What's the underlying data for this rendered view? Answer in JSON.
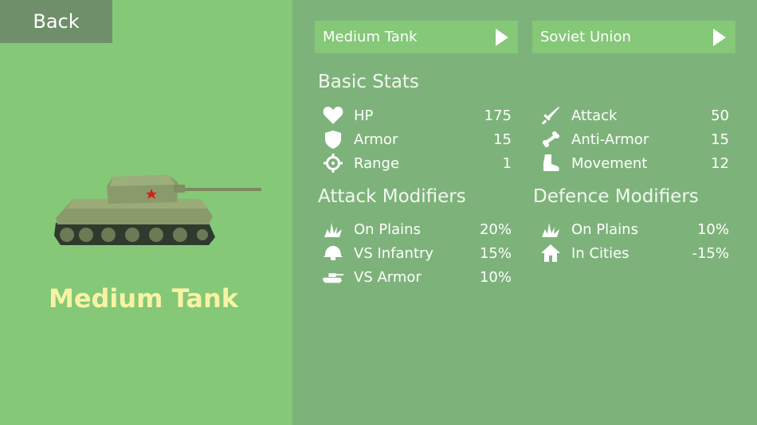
{
  "back_label": "Back",
  "unit": {
    "name": "Medium Tank",
    "selector": "Medium Tank",
    "nation": "Soviet Union"
  },
  "colors": {
    "left_panel": "#84c878",
    "right_panel": "#7db37a",
    "back_button": "#6e8f6a",
    "unit_name": "#f8f3a4",
    "tank_body": "#8a9a6a",
    "star": "#d42020"
  },
  "basic_stats": {
    "title": "Basic Stats",
    "left": [
      {
        "icon": "heart-icon",
        "name": "HP",
        "value": "175"
      },
      {
        "icon": "shield-icon",
        "name": "Armor",
        "value": "15"
      },
      {
        "icon": "crosshair-icon",
        "name": "Range",
        "value": "1"
      }
    ],
    "right": [
      {
        "icon": "sword-icon",
        "name": "Attack",
        "value": "50"
      },
      {
        "icon": "bone-icon",
        "name": "Anti-Armor",
        "value": "15"
      },
      {
        "icon": "boot-icon",
        "name": "Movement",
        "value": "12"
      }
    ]
  },
  "attack_modifiers": {
    "title": "Attack Modifiers",
    "rows": [
      {
        "icon": "grass-icon",
        "name": "On Plains",
        "value": "20%"
      },
      {
        "icon": "helmet-icon",
        "name": "VS Infantry",
        "value": "15%"
      },
      {
        "icon": "tank-icon",
        "name": "VS Armor",
        "value": "10%"
      }
    ]
  },
  "defence_modifiers": {
    "title": "Defence Modifiers",
    "rows": [
      {
        "icon": "grass-icon",
        "name": "On Plains",
        "value": "10%"
      },
      {
        "icon": "house-icon",
        "name": "In Cities",
        "value": "-15%"
      }
    ]
  }
}
